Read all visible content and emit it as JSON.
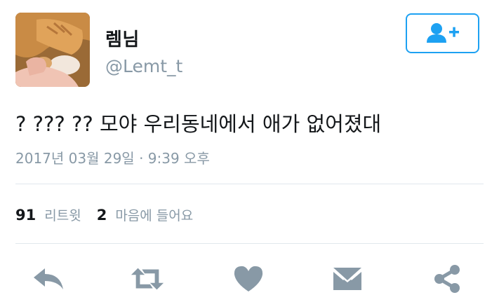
{
  "user": {
    "display_name": "렘님",
    "handle": "@Lemt_t"
  },
  "follow_button": {
    "icon": "add-user-icon",
    "color": "#1da1f2"
  },
  "tweet": {
    "text": "? ??? ?? 모야 우리동네에서 애가 없어졌대",
    "timestamp": "2017년 03월 29일 · 9:39 오후"
  },
  "stats": {
    "retweets_count": "91",
    "retweets_label": "리트윗",
    "likes_count": "2",
    "likes_label": "마음에 들어요"
  },
  "actions": [
    {
      "icon": "reply-icon"
    },
    {
      "icon": "retweet-icon"
    },
    {
      "icon": "heart-icon"
    },
    {
      "icon": "envelope-icon"
    },
    {
      "icon": "share-icon"
    }
  ],
  "colors": {
    "text": "#14171a",
    "secondary": "#8899a6",
    "divider": "#e1e8ed",
    "action_icon": "#8899a6"
  }
}
